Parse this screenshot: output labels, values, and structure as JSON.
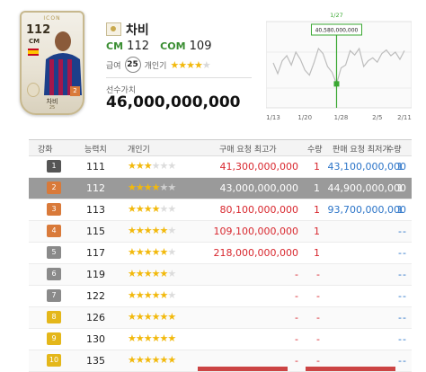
{
  "card": {
    "icon_tag": "ICON",
    "ovr": "112",
    "position": "CM",
    "level": "2",
    "name": "차비",
    "edition": "25"
  },
  "player": {
    "name": "차비",
    "stat1_label": "CM",
    "stat1_value": "112",
    "stat2_label": "COM",
    "stat2_value": "109",
    "pay_label": "급여",
    "pay_value": "25",
    "popularity_label": "개인기",
    "popularity_stars": 4,
    "value_label": "선수가치",
    "value": "46,000,000,000"
  },
  "price_chart": {
    "highlight_date": "1/27",
    "highlight_value": "40,580,000,000",
    "x_ticks": [
      "1/13",
      "1/20",
      "1/28",
      "2/5",
      "2/11"
    ]
  },
  "chart_data": {
    "type": "line",
    "title": "",
    "x": [
      "1/13",
      "1/14",
      "1/15",
      "1/16",
      "1/17",
      "1/18",
      "1/19",
      "1/20",
      "1/21",
      "1/22",
      "1/23",
      "1/24",
      "1/25",
      "1/26",
      "1/27",
      "1/28",
      "1/29",
      "1/30",
      "1/31",
      "2/1",
      "2/2",
      "2/3",
      "2/4",
      "2/5",
      "2/6",
      "2/7",
      "2/8",
      "2/9",
      "2/10",
      "2/11"
    ],
    "series": [
      {
        "values": [
          43.5,
          42.0,
          43.8,
          44.5,
          43.2,
          45.0,
          44.0,
          42.5,
          41.8,
          43.5,
          45.5,
          44.8,
          43.0,
          42.2,
          40.58,
          42.8,
          43.2,
          45.2,
          44.6,
          45.5,
          43.0,
          43.8,
          44.2,
          43.6,
          44.8,
          45.3,
          44.5,
          45.0,
          44.0,
          45.2
        ]
      }
    ],
    "xlabel": "",
    "ylabel": "",
    "x_ticks": [
      "1/13",
      "1/20",
      "1/28",
      "2/5",
      "2/11"
    ],
    "highlight": {
      "x": "1/27",
      "value": "40,580,000,000"
    }
  },
  "table": {
    "headers": {
      "enhance": "강화",
      "stat": "능력치",
      "skill": "개인기",
      "buy": "구매 요청 최고가",
      "buy_qty": "수량",
      "sell": "판매 요청 최저가",
      "sell_qty": "수량"
    },
    "rows": [
      {
        "level": "1",
        "color": "#555555",
        "stat": "111",
        "stars": 3,
        "buy": "41,300,000,000",
        "buy_qty": "1",
        "sell": "43,100,000,000",
        "sell_qty": "1"
      },
      {
        "level": "2",
        "color": "#d97a3a",
        "stat": "112",
        "stars": 4,
        "buy": "43,000,000,000",
        "buy_qty": "1",
        "sell": "44,900,000,000",
        "sell_qty": "1"
      },
      {
        "level": "3",
        "color": "#d97a3a",
        "stat": "113",
        "stars": 4,
        "buy": "80,100,000,000",
        "buy_qty": "1",
        "sell": "93,700,000,000",
        "sell_qty": "1"
      },
      {
        "level": "4",
        "color": "#d97a3a",
        "stat": "115",
        "stars": 5,
        "buy": "109,100,000,000",
        "buy_qty": "1",
        "sell": "-",
        "sell_qty": "-"
      },
      {
        "level": "5",
        "color": "#8a8a8a",
        "stat": "117",
        "stars": 5,
        "buy": "218,000,000,000",
        "buy_qty": "1",
        "sell": "-",
        "sell_qty": "-"
      },
      {
        "level": "6",
        "color": "#8a8a8a",
        "stat": "119",
        "stars": 5,
        "buy": "-",
        "buy_qty": "-",
        "sell": "-",
        "sell_qty": "-"
      },
      {
        "level": "7",
        "color": "#8a8a8a",
        "stat": "122",
        "stars": 5,
        "buy": "-",
        "buy_qty": "-",
        "sell": "-",
        "sell_qty": "-"
      },
      {
        "level": "8",
        "color": "#e4b71a",
        "stat": "126",
        "stars": 6,
        "buy": "-",
        "buy_qty": "-",
        "sell": "-",
        "sell_qty": "-"
      },
      {
        "level": "9",
        "color": "#e4b71a",
        "stat": "130",
        "stars": 6,
        "buy": "-",
        "buy_qty": "-",
        "sell": "-",
        "sell_qty": "-"
      },
      {
        "level": "10",
        "color": "#e4b71a",
        "stat": "135",
        "stars": 6,
        "buy": "-",
        "buy_qty": "-",
        "sell": "-",
        "sell_qty": "-"
      }
    ]
  }
}
